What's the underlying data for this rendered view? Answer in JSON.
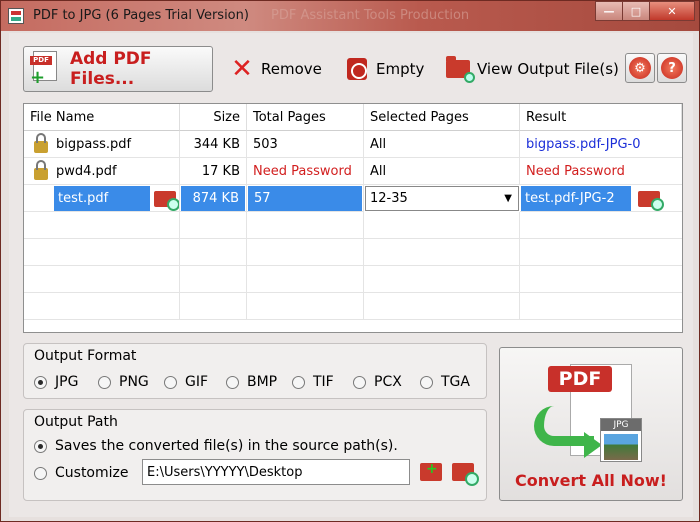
{
  "window": {
    "title": "PDF to JPG (6 Pages Trial Version)",
    "ghost_title": "PDF Assistant Tools Production",
    "min_label": "—",
    "max_label": "□",
    "close_label": "✕"
  },
  "toolbar": {
    "add_label": "Add PDF Files...",
    "remove_label": "Remove",
    "empty_label": "Empty",
    "view_output_label": "View Output File(s)",
    "settings_glyph": "⚙",
    "help_glyph": "?"
  },
  "table": {
    "headers": {
      "file_name": "File Name",
      "size": "Size",
      "total_pages": "Total Pages",
      "selected_pages": "Selected Pages",
      "result": "Result"
    },
    "rows": [
      {
        "file_name": "bigpass.pdf",
        "size": "344 KB",
        "total_pages": "503",
        "selected_pages": "All",
        "result": "bigpass.pdf-JPG-0",
        "locked": true
      },
      {
        "file_name": "pwd4.pdf",
        "size": "17 KB",
        "total_pages": "Need Password",
        "selected_pages": "All",
        "result": "Need Password",
        "locked": true
      },
      {
        "file_name": "test.pdf",
        "size": "874 KB",
        "total_pages": "57",
        "selected_pages": "12-35",
        "result": "test.pdf-JPG-2",
        "locked": false
      }
    ]
  },
  "output_format": {
    "title": "Output Format",
    "options": [
      "JPG",
      "PNG",
      "GIF",
      "BMP",
      "TIF",
      "PCX",
      "TGA"
    ],
    "selected": "JPG"
  },
  "output_path": {
    "title": "Output Path",
    "source_option": "Saves the converted file(s) in the source path(s).",
    "customize_option": "Customize",
    "customize_value": "E:\\Users\\YYYYY\\Desktop",
    "selected": "source"
  },
  "convert": {
    "pdf_tag": "PDF",
    "jpg_tag": "JPG",
    "label": "Convert All Now!"
  },
  "colors": {
    "accent_red": "#c81e1e",
    "link_blue": "#1c2fd8",
    "selection_blue": "#3a8be8",
    "arrow_green": "#3fb54a"
  },
  "icons": {
    "add": "pdf-add-icon",
    "remove": "x-icon",
    "empty": "recycle-bin-icon",
    "view_output": "folder-magnifier-icon",
    "settings": "wrench-icon",
    "help": "help-icon",
    "lock": "lock-icon"
  }
}
